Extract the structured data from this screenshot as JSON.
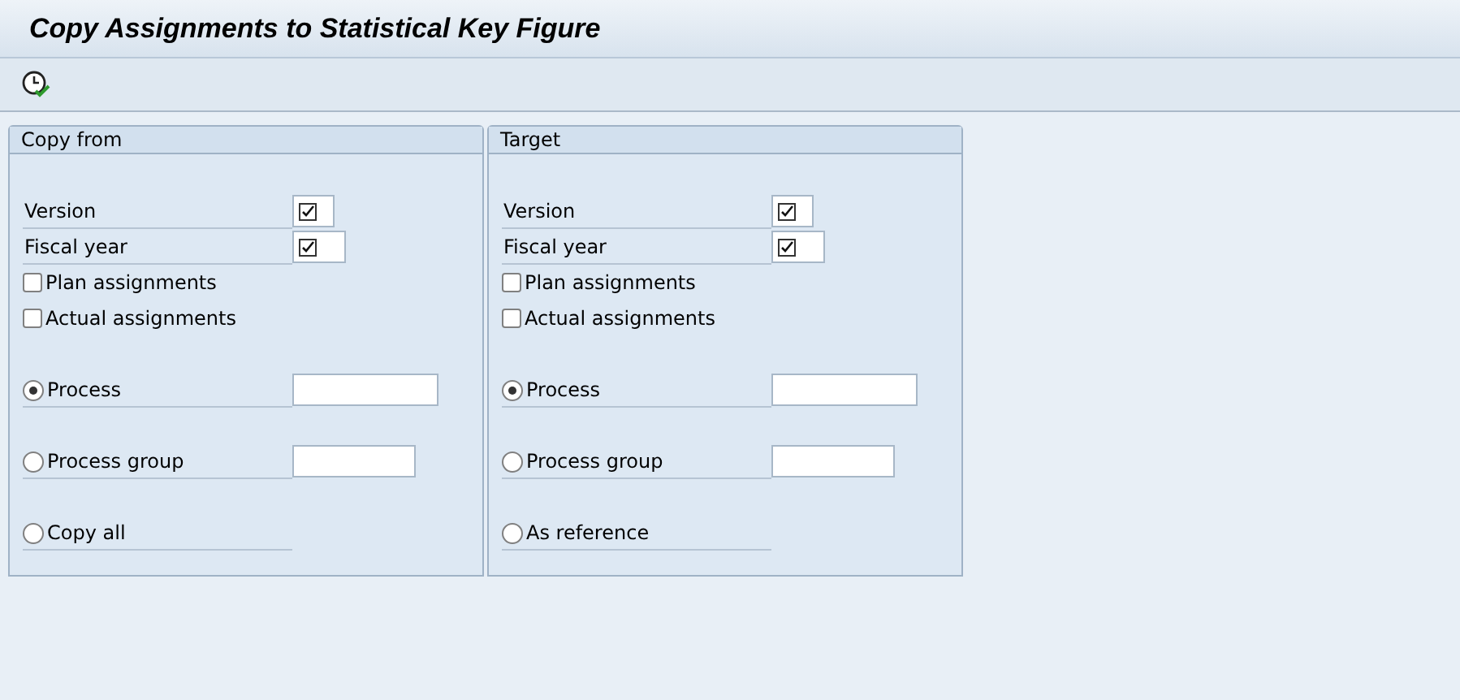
{
  "window": {
    "title": "Copy Assignments to Statistical Key Figure"
  },
  "panels": [
    {
      "title": "Copy from",
      "rows": [
        {
          "kind": "required",
          "label": "Version"
        },
        {
          "kind": "required",
          "label": "Fiscal year"
        },
        {
          "kind": "checkbox",
          "label": "Plan assignments",
          "checked": false
        },
        {
          "kind": "checkbox",
          "label": "Actual assignments",
          "checked": false
        },
        {
          "kind": "radio",
          "label": "Process",
          "selected": true,
          "field": true
        },
        {
          "kind": "radio",
          "label": "Process group",
          "selected": false,
          "field": true
        },
        {
          "kind": "radio",
          "label": "Copy all",
          "selected": false,
          "field": false
        }
      ]
    },
    {
      "title": "Target",
      "rows": [
        {
          "kind": "required",
          "label": "Version"
        },
        {
          "kind": "required",
          "label": "Fiscal year"
        },
        {
          "kind": "checkbox",
          "label": "Plan assignments",
          "checked": false
        },
        {
          "kind": "checkbox",
          "label": "Actual assignments",
          "checked": false
        },
        {
          "kind": "radio",
          "label": "Process",
          "selected": true,
          "field": true
        },
        {
          "kind": "radio",
          "label": "Process group",
          "selected": false,
          "field": true
        },
        {
          "kind": "radio",
          "label": "As reference",
          "selected": false,
          "field": false
        }
      ]
    }
  ]
}
